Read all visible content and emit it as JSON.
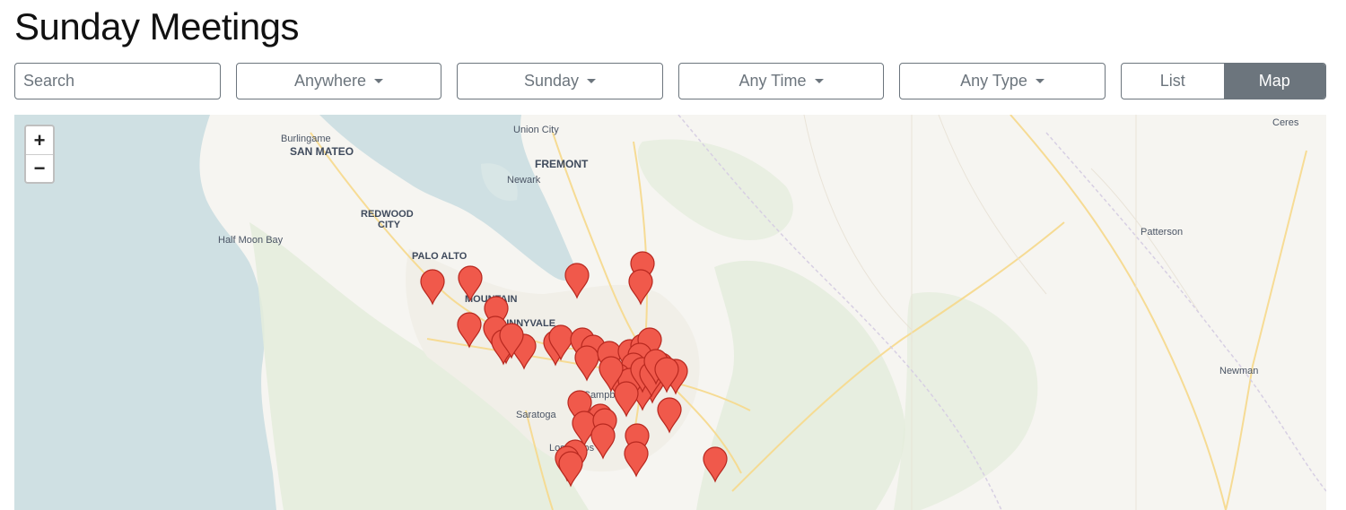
{
  "page": {
    "title": "Sunday Meetings"
  },
  "filters": {
    "search_placeholder": "Search",
    "region": "Anywhere",
    "day": "Sunday",
    "time": "Any Time",
    "type": "Any Type"
  },
  "view_toggle": {
    "list": "List",
    "map": "Map",
    "active": "Map"
  },
  "map": {
    "zoom_in": "+",
    "zoom_out": "−",
    "labels": {
      "union_city": "Union City",
      "burlingame": "Burlingame",
      "san_mateo": "SAN MATEO",
      "fremont": "FREMONT",
      "newark": "Newark",
      "redwood_city_1": "REDWOOD",
      "redwood_city_2": "CITY",
      "half_moon_bay": "Half Moon Bay",
      "palo_alto": "PALO ALTO",
      "mountain_view": "MOUNTAIN",
      "sunnyvale": "SUNNYVALE",
      "campbell": "Campbell",
      "saratoga": "Saratoga",
      "los_gatos": "Los Gatos",
      "ceres": "Ceres",
      "patterson": "Patterson",
      "newman": "Newman"
    },
    "marker_count": 48,
    "marker_color": "#f0594b",
    "water_color": "#cfe0e3",
    "land_color": "#f6f5f1"
  }
}
